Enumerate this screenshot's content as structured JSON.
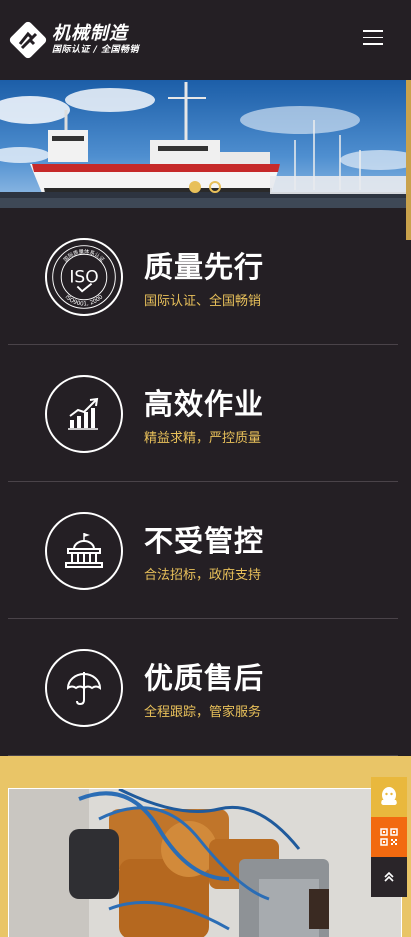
{
  "header": {
    "logo_title": "机械制造",
    "logo_subtitle": "国际认证 / 全国畅销",
    "menu_icon": "hamburger-menu-icon"
  },
  "banner": {
    "slide_count": 2,
    "active_slide": 1
  },
  "features": [
    {
      "title": "质量先行",
      "subtitle": "国际认证、全国畅销",
      "icon": "iso-certificate-icon",
      "iso_text": "ISO",
      "iso_ring": "国际质量体系认证",
      "iso_number": "ISO9001, 2000"
    },
    {
      "title": "高效作业",
      "subtitle": "精益求精，严控质量",
      "icon": "growth-chart-icon"
    },
    {
      "title": "不受管控",
      "subtitle": "合法招标，政府支持",
      "icon": "government-building-icon"
    },
    {
      "title": "优质售后",
      "subtitle": "全程跟踪，管家服务",
      "icon": "umbrella-icon"
    }
  ],
  "sidebar": {
    "items": [
      "qq-icon",
      "qr-code-icon",
      "back-to-top-icon"
    ]
  },
  "colors": {
    "background": "#241f24",
    "accent": "#e8c05a",
    "orange": "#f26a10"
  }
}
